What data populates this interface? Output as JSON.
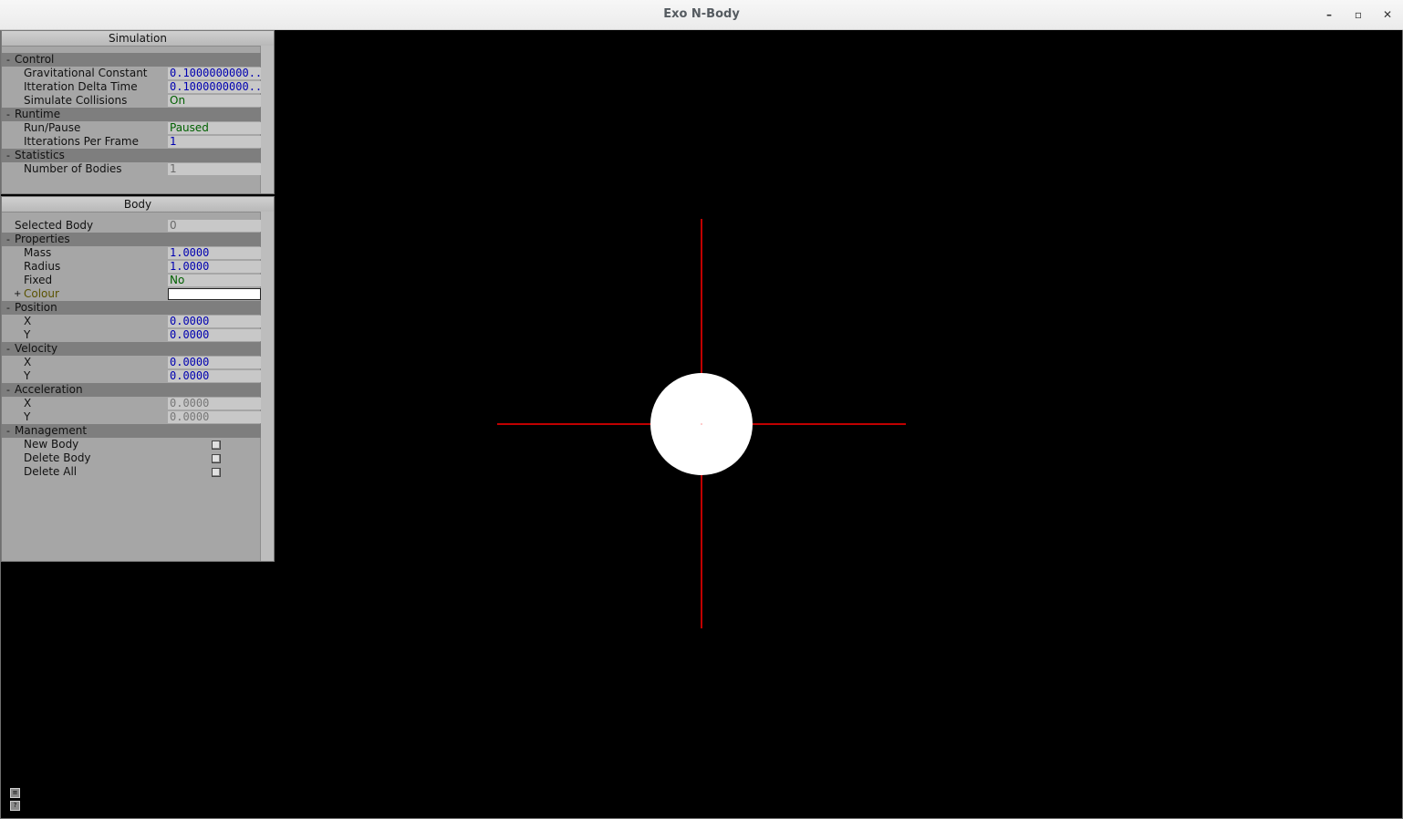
{
  "window": {
    "title": "Exo N-Body",
    "controls": [
      "minimize-icon",
      "maximize-icon",
      "close-icon"
    ],
    "minimize_glyph": "–",
    "maximize_glyph": "▫",
    "close_glyph": "✕"
  },
  "simulation_panel": {
    "title": "Simulation",
    "control": {
      "label": "Control",
      "gravitational_constant": {
        "label": "Gravitational Constant",
        "value": "0.1000000000.."
      },
      "iteration_delta_time": {
        "label": "Itteration Delta Time",
        "value": "0.1000000000.."
      },
      "simulate_collisions": {
        "label": "Simulate Collisions",
        "value": "On"
      }
    },
    "runtime": {
      "label": "Runtime",
      "run_pause": {
        "label": "Run/Pause",
        "value": "Paused"
      },
      "iterations_per_frame": {
        "label": "Itterations Per Frame",
        "value": "1"
      }
    },
    "statistics": {
      "label": "Statistics",
      "number_of_bodies": {
        "label": "Number of Bodies",
        "value": "1"
      }
    }
  },
  "body_panel": {
    "title": "Body",
    "selected_body": {
      "label": "Selected Body",
      "value": "0"
    },
    "properties": {
      "label": "Properties",
      "mass": {
        "label": "Mass",
        "value": "1.0000"
      },
      "radius": {
        "label": "Radius",
        "value": "1.0000"
      },
      "fixed": {
        "label": "Fixed",
        "value": "No"
      },
      "colour": {
        "label": "Colour",
        "value": "#ffffff"
      }
    },
    "position": {
      "label": "Position",
      "x": {
        "label": "X",
        "value": "0.0000"
      },
      "y": {
        "label": "Y",
        "value": "0.0000"
      }
    },
    "velocity": {
      "label": "Velocity",
      "x": {
        "label": "X",
        "value": "0.0000"
      },
      "y": {
        "label": "Y",
        "value": "0.0000"
      }
    },
    "acceleration": {
      "label": "Acceleration",
      "x": {
        "label": "X",
        "value": "0.0000"
      },
      "y": {
        "label": "Y",
        "value": "0.0000"
      }
    },
    "management": {
      "label": "Management",
      "new_body": {
        "label": "New Body"
      },
      "delete_body": {
        "label": "Delete Body"
      },
      "delete_all": {
        "label": "Delete All"
      }
    }
  },
  "colors": {
    "background": "#000000",
    "crosshair": "#c00000",
    "body": "#ffffff"
  }
}
